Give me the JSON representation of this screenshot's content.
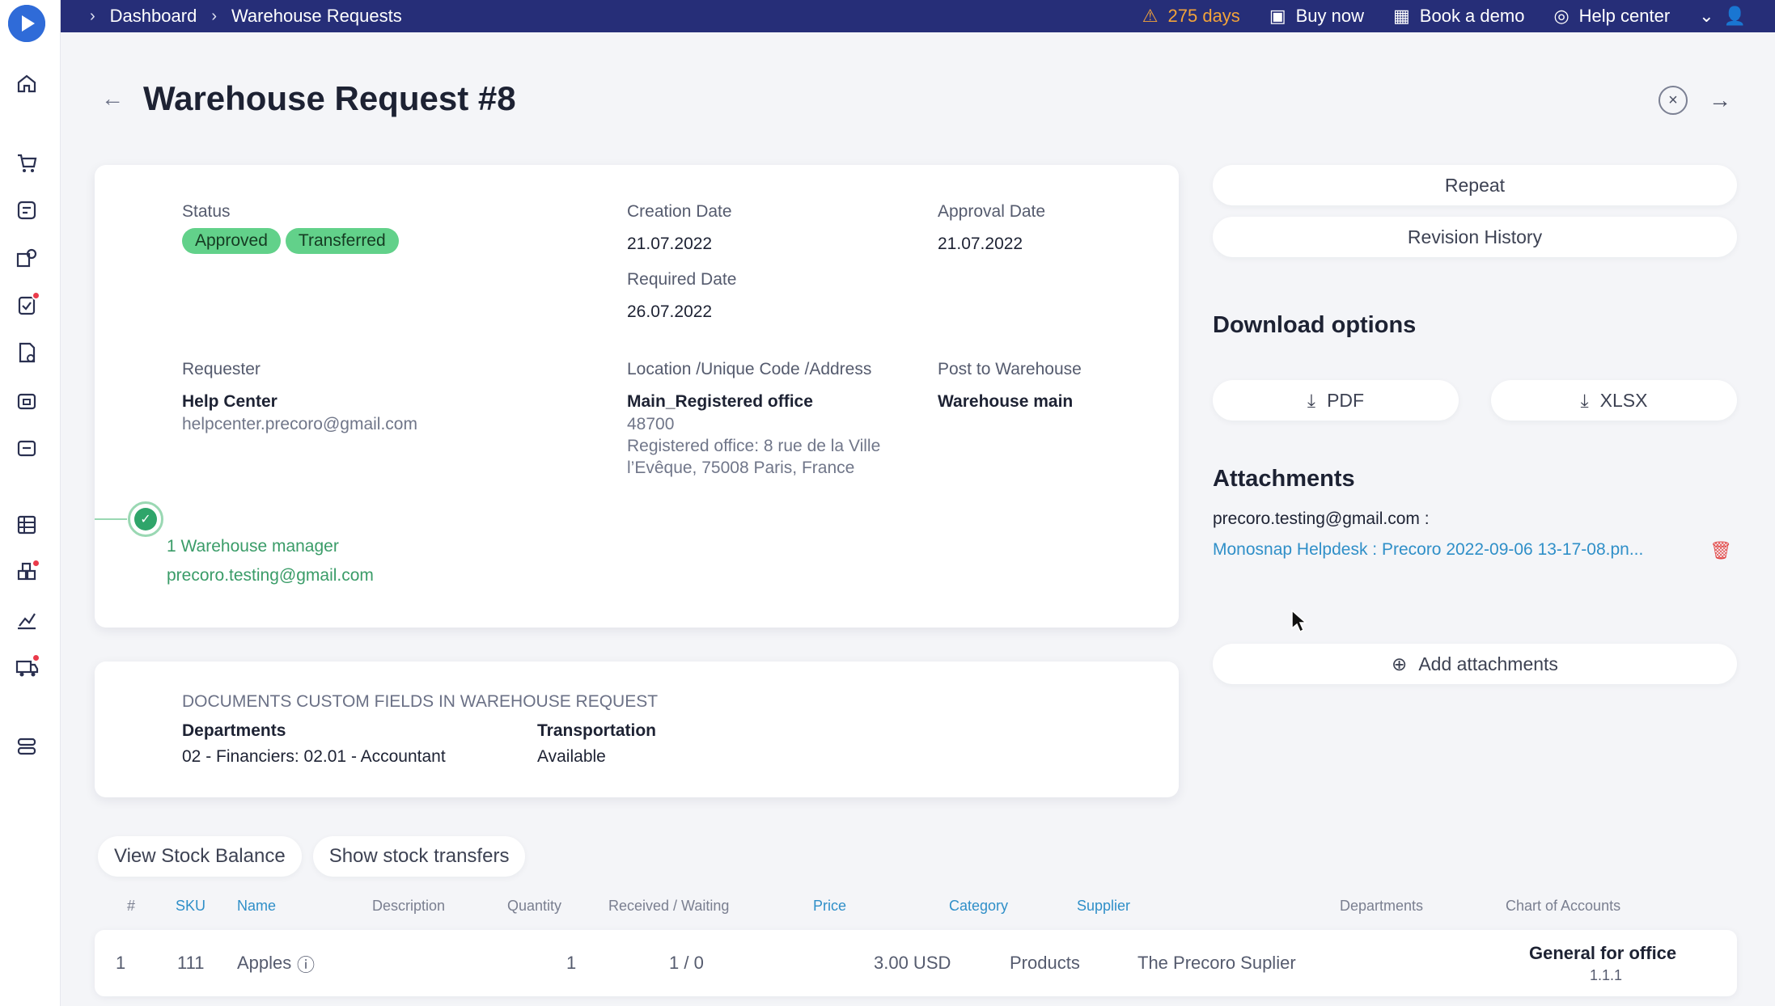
{
  "sidebar": {
    "items": [
      "home-icon",
      "cart-icon",
      "requests-icon",
      "suppliers-icon",
      "approvals-icon",
      "invoices-icon",
      "warehouse-icon",
      "stock-icon",
      "budget-icon",
      "inventory-icon",
      "analytics-icon",
      "delivery-icon",
      "settings-icon"
    ]
  },
  "topbar": {
    "breadcrumbs": [
      "Dashboard",
      "Warehouse Requests"
    ],
    "trial": "275 days",
    "buy_now": "Buy now",
    "book_demo": "Book a demo",
    "help_center": "Help center"
  },
  "page": {
    "title": "Warehouse Request #8"
  },
  "details": {
    "status_label": "Status",
    "status_badges": [
      "Approved",
      "Transferred"
    ],
    "creation_label": "Creation Date",
    "creation_value": "21.07.2022",
    "approval_label": "Approval Date",
    "approval_value": "21.07.2022",
    "required_label": "Required Date",
    "required_value": "26.07.2022",
    "requester_label": "Requester",
    "requester_name": "Help Center",
    "requester_email": "helpcenter.precoro@gmail.com",
    "location_label": "Location /Unique Code /Address",
    "location_name": "Main_Registered office",
    "location_code": "48700",
    "location_address_1": "Registered office: 8 rue de la Ville",
    "location_address_2": "l’Evêque, 75008 Paris, France",
    "warehouse_label": "Post to Warehouse",
    "warehouse_value": "Warehouse main",
    "approval_step": "1 Warehouse manager",
    "approval_email": "precoro.testing@gmail.com"
  },
  "custom_fields": {
    "heading": "DOCUMENTS CUSTOM FIELDS IN WAREHOUSE REQUEST",
    "departments_label": "Departments",
    "departments_value": "02 - Financiers: 02.01 - Accountant",
    "transportation_label": "Transportation",
    "transportation_value": "Available"
  },
  "right_panel": {
    "repeat": "Repeat",
    "revision_history": "Revision History",
    "download_title": "Download options",
    "pdf": "PDF",
    "xlsx": "XLSX",
    "attachments_title": "Attachments",
    "attachment_owner": "precoro.testing@gmail.com :",
    "attachment_file": "Monosnap Helpdesk : Precoro 2022-09-06 13-17-08.pn...",
    "add_attachments": "Add attachments"
  },
  "actions": {
    "view_stock": "View Stock Balance",
    "show_transfers": "Show stock transfers"
  },
  "table": {
    "headers": [
      "#",
      "SKU",
      "Name",
      "Description",
      "Quantity",
      "Received / Waiting",
      "Price",
      "Category",
      "Supplier",
      "Departments",
      "Chart of Accounts"
    ],
    "rows": [
      {
        "num": "1",
        "sku": "111",
        "name": "Apples",
        "description": "",
        "quantity": "1",
        "received": "1 / 0",
        "price": "3.00 USD",
        "category": "Products",
        "supplier": "The Precoro Suplier",
        "departments": "",
        "chart_title": "General for office",
        "chart_code": "1.1.1"
      }
    ]
  }
}
